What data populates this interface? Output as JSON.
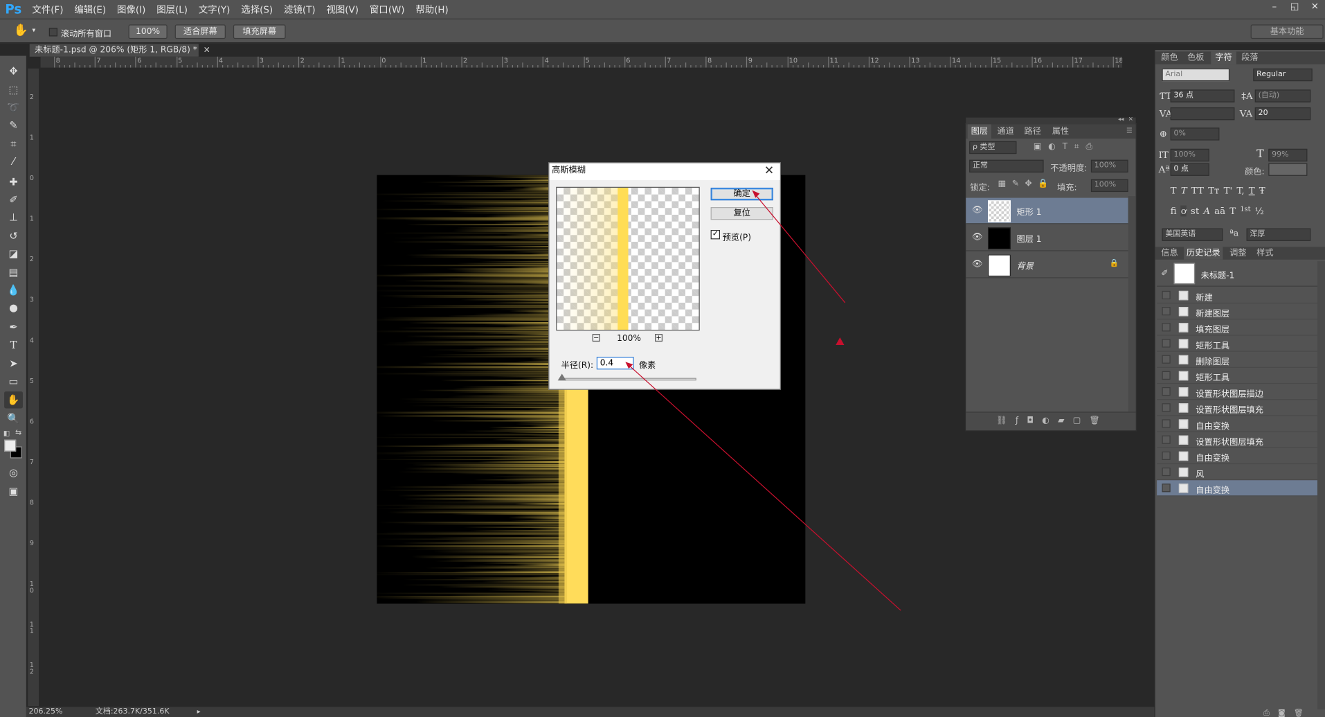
{
  "app": {
    "logo": "Ps"
  },
  "menu": [
    "文件(F)",
    "编辑(E)",
    "图像(I)",
    "图层(L)",
    "文字(Y)",
    "选择(S)",
    "滤镜(T)",
    "视图(V)",
    "窗口(W)",
    "帮助(H)"
  ],
  "window_buttons": [
    "–",
    "◱",
    "✕"
  ],
  "options_bar": {
    "scroll_all_label": "滚动所有窗口",
    "zoom_btn": "100%",
    "fit_btn": "适合屏幕",
    "fill_btn": "填充屏幕",
    "workspace": "基本功能"
  },
  "document": {
    "tab_title": "未标题-1.psd @ 206% (矩形 1, RGB/8) *",
    "close": "×"
  },
  "hruler_labels": [
    "8",
    "7",
    "6",
    "5",
    "4",
    "3",
    "2",
    "1",
    "0",
    "1",
    "2",
    "3",
    "4",
    "5",
    "6",
    "7",
    "8",
    "9",
    "10",
    "11",
    "12",
    "13",
    "14",
    "15",
    "16",
    "17",
    "18"
  ],
  "vruler_labels": [
    "2",
    "1",
    "0",
    "1",
    "2",
    "3",
    "4",
    "5",
    "6",
    "7",
    "8",
    "9",
    "1\n0",
    "1\n1",
    "1\n2"
  ],
  "dialog": {
    "title": "高斯模糊",
    "ok": "确定",
    "reset": "复位",
    "preview_label": "预览(P)",
    "preview_checked": true,
    "zoom_minus": "−",
    "zoom_level": "100%",
    "zoom_plus": "+",
    "radius_label": "半径(R):",
    "radius_value": "0.4",
    "unit": "像素"
  },
  "layers_panel": {
    "tabs": [
      "图层",
      "通道",
      "路径",
      "属性"
    ],
    "filter_label": "ρ 类型",
    "blend_mode": "正常",
    "opacity_label": "不透明度:",
    "opacity_value": "100%",
    "lock_label": "锁定:",
    "fill_label": "填充:",
    "fill_value": "100%",
    "layers": [
      {
        "name": "矩形 1",
        "selected": true
      },
      {
        "name": "图层 1",
        "selected": false
      },
      {
        "name": "背景",
        "selected": false,
        "locked": true
      }
    ],
    "bottom_icons": [
      "link-icon",
      "fx-icon",
      "mask-icon",
      "adjustment-icon",
      "group-icon",
      "new-layer-icon",
      "trash-icon"
    ]
  },
  "character_panel": {
    "tabs": [
      "颜色",
      "色板",
      "字符",
      "段落"
    ],
    "font_family": "Arial",
    "font_style": "Regular",
    "size": "36 点",
    "leading": "(自动)",
    "kerning": "",
    "tracking": "20",
    "tsume": "0%",
    "vscale": "100%",
    "hscale": "99%",
    "baseline": "0 点",
    "color_label": "颜色:",
    "style_buttons": [
      "T",
      "T",
      "TT",
      "Tт",
      "T'",
      "T,",
      "T",
      "Ŧ"
    ],
    "ot_buttons": [
      "fi",
      "ơ",
      "st",
      "A",
      "aā",
      "T",
      "1st",
      "½"
    ],
    "language": "美国英语",
    "aa_label": "ªa",
    "aa_mode": "浑厚"
  },
  "history_panel": {
    "tabs": [
      "信息",
      "历史记录",
      "调整",
      "样式"
    ],
    "snapshot": "未标题-1",
    "items": [
      "新建",
      "新建图层",
      "填充图层",
      "矩形工具",
      "删除图层",
      "矩形工具",
      "设置形状图层描边",
      "设置形状图层填充",
      "自由变换",
      "设置形状图层填充",
      "自由变换",
      "风",
      "自由变换"
    ],
    "selected_index": 12
  },
  "status": {
    "zoom": "206.25%",
    "doc": "文档:263.7K/351.6K"
  },
  "colors": {
    "accent": "#31a8ff",
    "selection": "#6d7c93",
    "glow": "#ffdc5a",
    "arrow": "#c8102e"
  }
}
